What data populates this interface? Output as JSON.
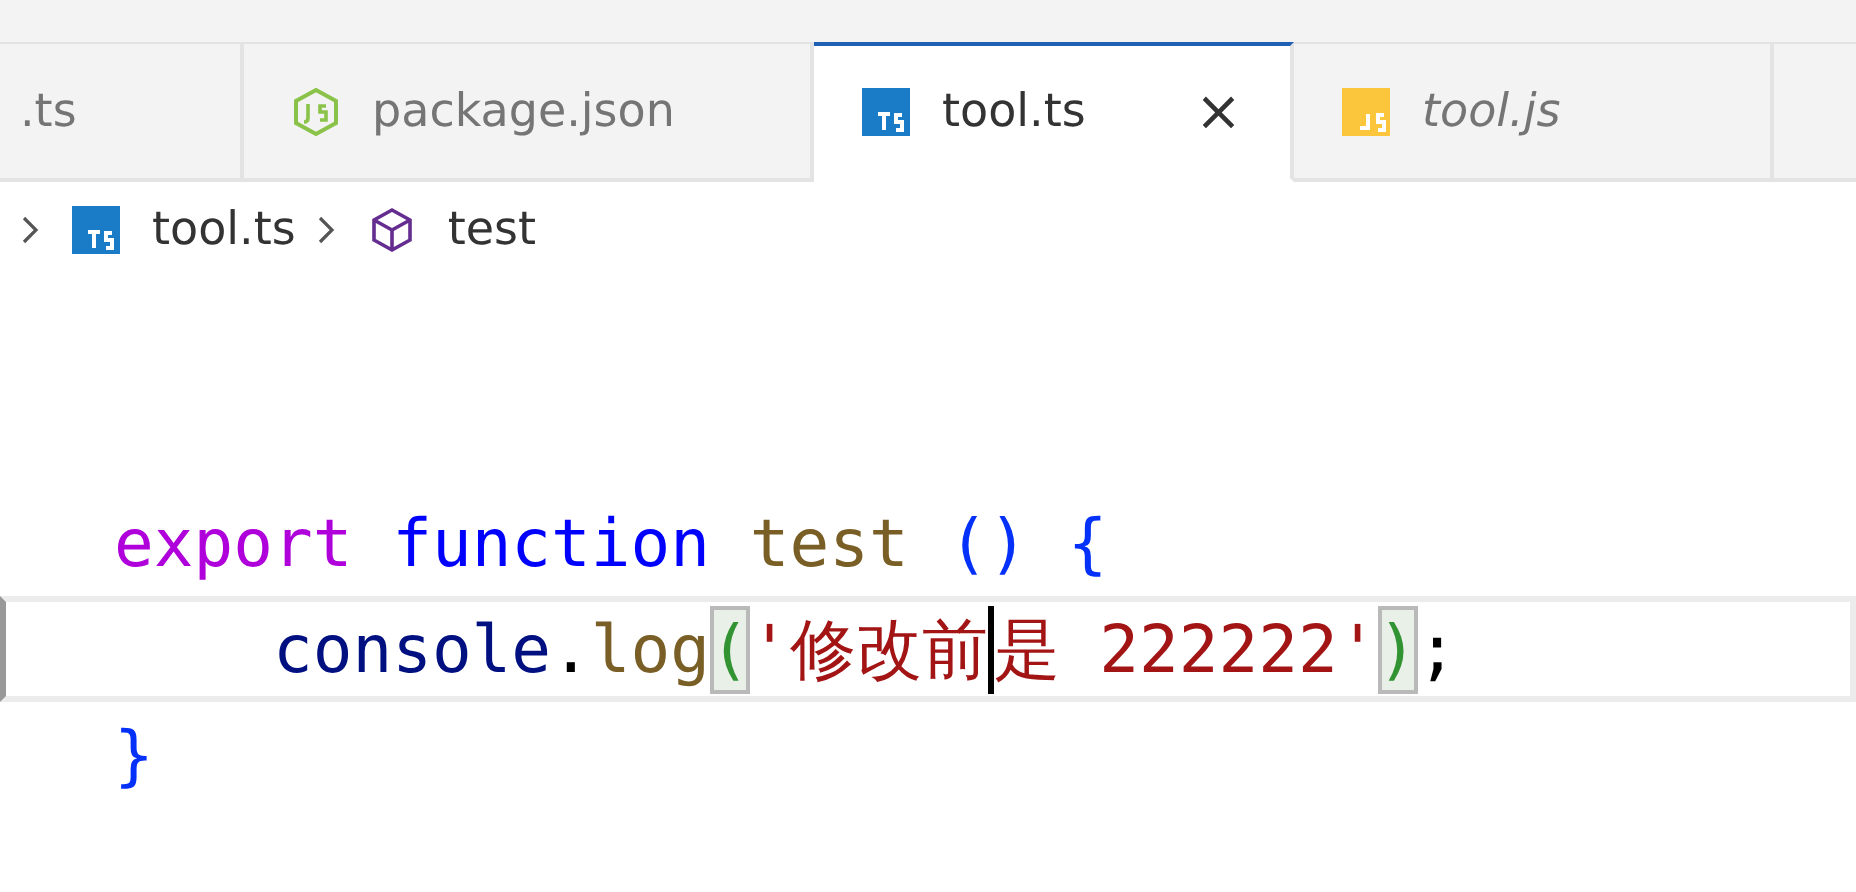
{
  "tabs": [
    {
      "label": ".ts",
      "selected": false,
      "preview": false
    },
    {
      "label": "package.json",
      "kind": "node",
      "selected": false,
      "preview": false
    },
    {
      "label": "tool.ts",
      "kind": "ts",
      "selected": true,
      "preview": false,
      "close": "×"
    },
    {
      "label": "tool.js",
      "kind": "js",
      "selected": false,
      "preview": true
    }
  ],
  "breadcrumb": [
    {
      "label": "tool.ts",
      "kind": "ts"
    },
    {
      "label": "test",
      "kind": "symbol"
    }
  ],
  "code_lines": [
    {
      "current": false,
      "tokens": [
        {
          "text": "export ",
          "kind": "keyword"
        },
        {
          "text": "function ",
          "kind": "storage"
        },
        {
          "text": "test ",
          "kind": "function"
        },
        {
          "text": "() {",
          "kind": "brace"
        }
      ]
    },
    {
      "current": true,
      "tokens": [
        {
          "text": "    console",
          "kind": "variable"
        },
        {
          "text": ".",
          "kind": "plain"
        },
        {
          "text": "log",
          "kind": "function"
        },
        {
          "text": "(",
          "kind": "bracket-match"
        },
        {
          "text": "'修改前",
          "kind": "string",
          "cursor_after": true
        },
        {
          "text": "是 222222'",
          "kind": "string"
        },
        {
          "text": ")",
          "kind": "bracket-match"
        },
        {
          "text": ";",
          "kind": "plain"
        }
      ]
    },
    {
      "current": false,
      "tokens": [
        {
          "text": "}",
          "kind": "brace"
        }
      ]
    }
  ]
}
